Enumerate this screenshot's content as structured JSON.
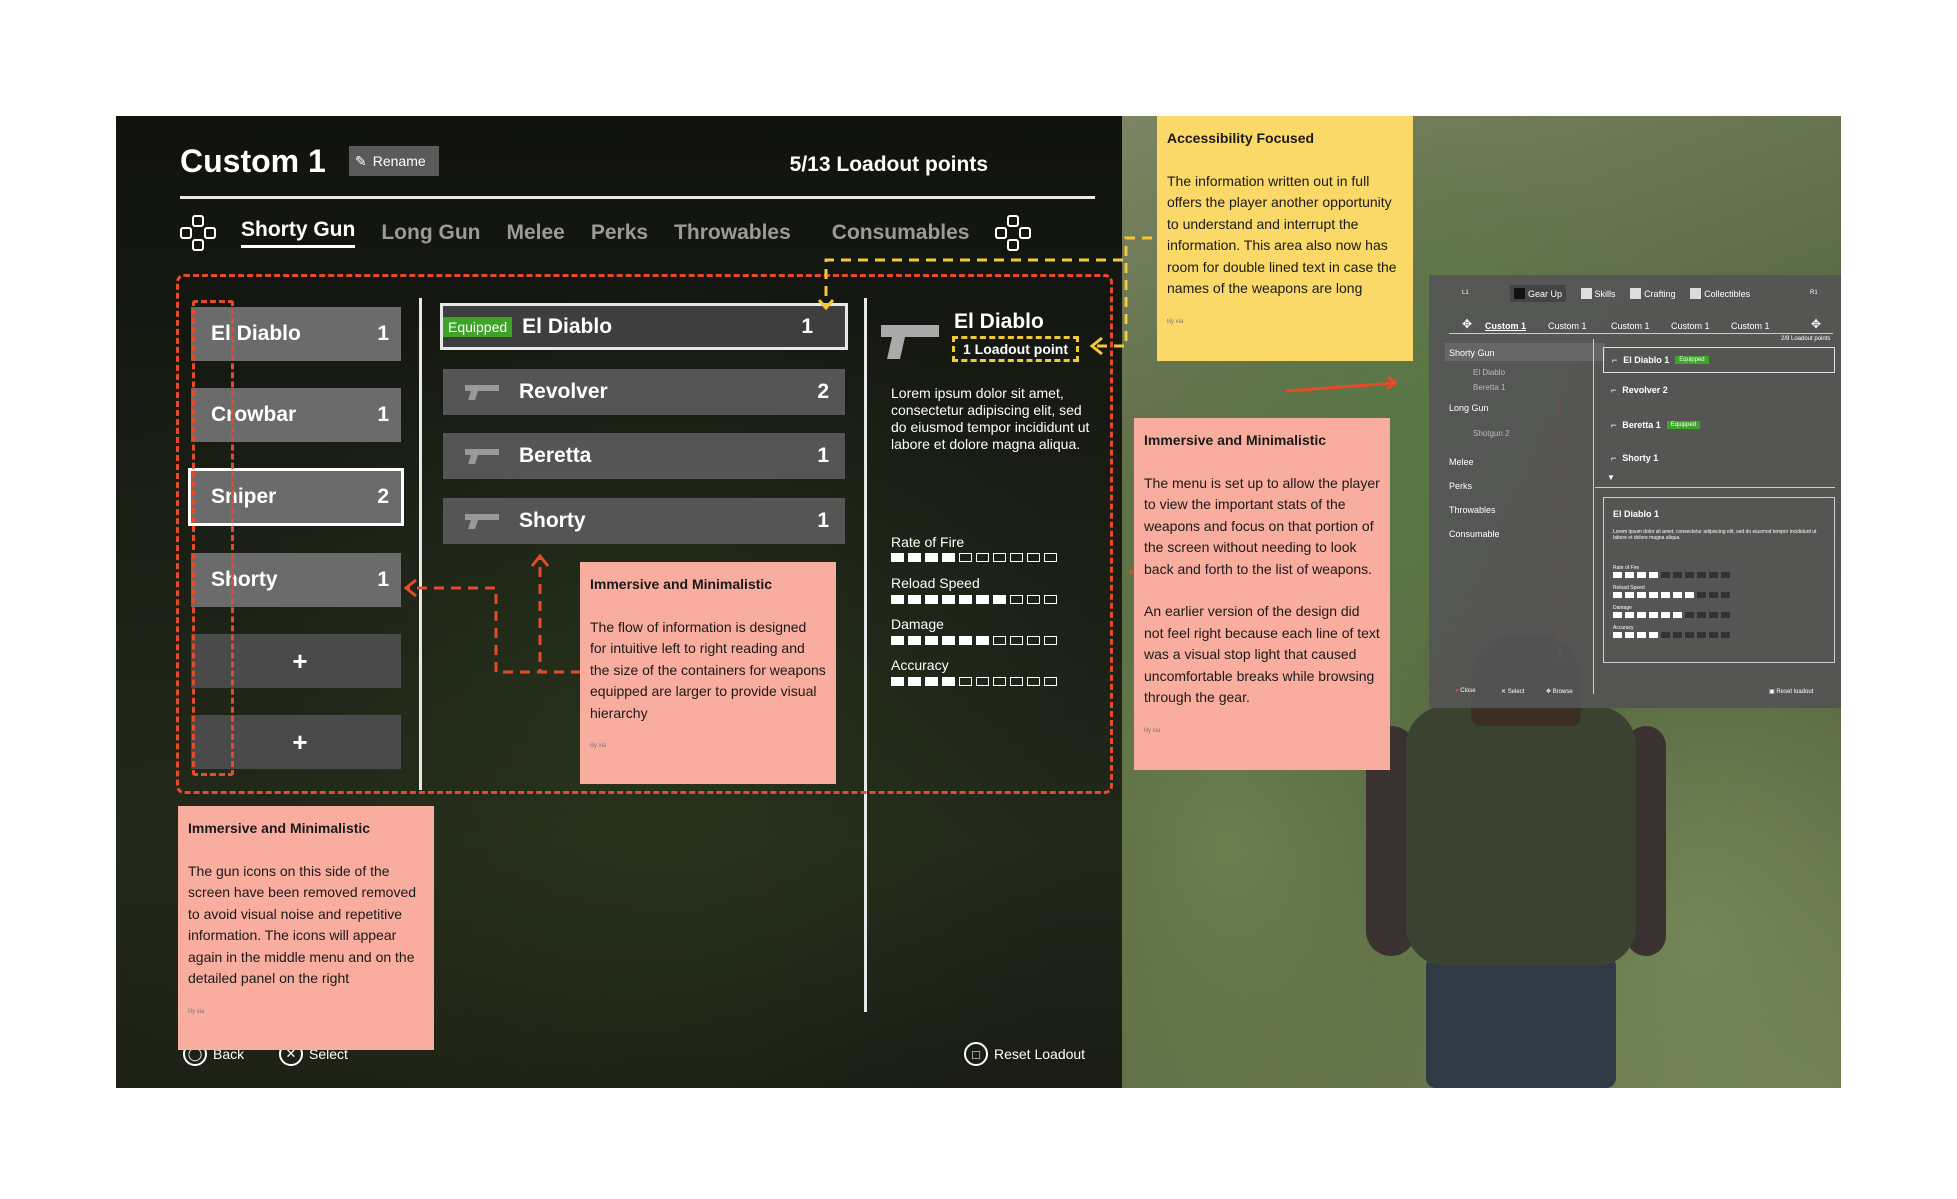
{
  "header": {
    "loadout_title": "Custom 1",
    "rename_label": "Rename",
    "loadout_points": "5/13 Loadout points"
  },
  "tabs": [
    "Shorty Gun",
    "Long Gun",
    "Melee",
    "Perks",
    "Throwables",
    "Consumables"
  ],
  "slots": [
    {
      "name": "El Diablo",
      "count": "1"
    },
    {
      "name": "Crowbar",
      "count": "1"
    },
    {
      "name": "Sniper",
      "count": "2"
    },
    {
      "name": "Shorty",
      "count": "1"
    },
    {
      "name": "+"
    },
    {
      "name": "+"
    }
  ],
  "guns": [
    {
      "tag": "Equipped",
      "name": "El Diablo",
      "count": "1"
    },
    {
      "name": "Revolver",
      "count": "2"
    },
    {
      "name": "Beretta",
      "count": "1"
    },
    {
      "name": "Shorty",
      "count": "1"
    }
  ],
  "detail": {
    "title": "El Diablo",
    "points": "1 Loadout point",
    "description": "Lorem ipsum dolor sit amet, consectetur adipiscing elit, sed do eiusmod tempor incididunt ut labore et dolore magna aliqua.",
    "stats": [
      {
        "label": "Rate of Fire",
        "filled": 4,
        "total": 10
      },
      {
        "label": "Reload Speed",
        "filled": 7,
        "total": 10
      },
      {
        "label": "Damage",
        "filled": 6,
        "total": 10
      },
      {
        "label": "Accuracy",
        "filled": 4,
        "total": 10
      }
    ]
  },
  "footer": {
    "back": "Back",
    "select": "Select",
    "reset": "Reset Loadout"
  },
  "notes": [
    {
      "heading": "Immersive and Minimalistic",
      "body": "The gun icons on this side of the screen have been removed removed to avoid visual noise and repetitive information. The icons will appear again in the middle menu and on the detailed panel on the right",
      "author": "lily xia",
      "color": "#f9ad9f"
    },
    {
      "heading": "Immersive and Minimalistic",
      "body": "The flow of information is designed for intuitive left to right reading and the size of the containers for weapons equipped are larger to provide visual hierarchy",
      "author": "lily xia",
      "color": "#f9ad9f"
    },
    {
      "heading": "Accessibility Focused",
      "body": "The information written out in full offers the player another opportunity to understand and interrupt the information. This area also now has room for double lined text in case the names of the weapons are long",
      "author": "lily xia",
      "color": "#fbd969"
    },
    {
      "heading": "Immersive and Minimalistic",
      "body1": "The menu is set up to allow the player to view the important stats of the weapons and focus on that portion of the screen without needing to look back and forth to the list of weapons.",
      "body2": "An earlier version of the design did not feel right because each line of text was a visual stop light that caused uncomfortable breaks while browsing through the gear.",
      "author": "lily xia",
      "color": "#f9ad9f"
    }
  ],
  "mini": {
    "l1": "L1",
    "r1": "R1",
    "tabs": [
      "Gear Up",
      "Skills",
      "Crafting",
      "Collectibles"
    ],
    "loadouts": [
      "Custom 1",
      "Custom 1",
      "Custom 1",
      "Custom 1",
      "Custom 1"
    ],
    "points": "2/8 Loadout points",
    "categories": [
      "Shorty Gun",
      "El Diablo",
      "Beretta  1",
      "Long Gun",
      "Shotgun 2",
      "Melee",
      "Perks",
      "Throwables",
      "Consumable"
    ],
    "weapons": [
      {
        "name": "El Diablo  1",
        "tag": "Equipped"
      },
      {
        "name": "Revolver 2"
      },
      {
        "name": "Beretta  1",
        "tag": "Equipped"
      },
      {
        "name": "Shorty 1"
      }
    ],
    "detail_title": "El Diablo  1",
    "detail_desc": "Lorem ipsum dolor sit amet, consectetur adipiscing elit, sed do eiusmod tempor incididunt ut labore et dolore magna aliqua.",
    "stats": [
      {
        "label": "Rate of Fire",
        "filled": 4,
        "total": 10
      },
      {
        "label": "Reload Speed",
        "filled": 7,
        "total": 10
      },
      {
        "label": "Damage",
        "filled": 6,
        "total": 10
      },
      {
        "label": "Accuracy",
        "filled": 4,
        "total": 10
      }
    ],
    "footer": [
      "Close",
      "Select",
      "Browse",
      "Reset loadout"
    ]
  },
  "colors": {
    "accent_red": "#e44b2a",
    "accent_yellow": "#f2c83a",
    "equipped_green": "#3ea428",
    "note_pink": "#f9ad9f",
    "note_yellow": "#fbd969"
  }
}
